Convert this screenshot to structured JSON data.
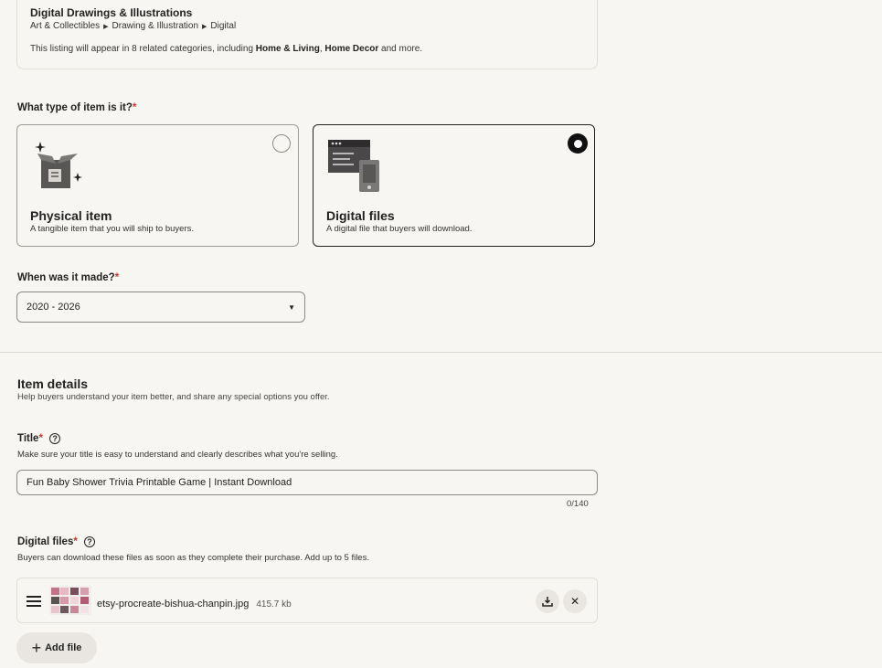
{
  "category": {
    "title": "Digital Drawings & Illustrations",
    "breadcrumb": [
      "Art & Collectibles",
      "Drawing & Illustration",
      "Digital"
    ],
    "note_prefix": "This listing will appear in 8 related categories, including ",
    "note_bold1": "Home & Living",
    "note_sep": ", ",
    "note_bold2": "Home Decor",
    "note_suffix": " and more."
  },
  "item_type": {
    "question": "What type of item is it?",
    "required_mark": "*",
    "options": [
      {
        "title": "Physical item",
        "desc": "A tangible item that you will ship to buyers.",
        "selected": false,
        "icon": "box-icon"
      },
      {
        "title": "Digital files",
        "desc": "A digital file that buyers will download.",
        "selected": true,
        "icon": "digital-files-icon"
      }
    ]
  },
  "when_made": {
    "question": "When was it made?",
    "required_mark": "*",
    "selected": "2020 - 2026"
  },
  "item_details": {
    "title": "Item details",
    "subtitle": "Help buyers understand your item better, and share any special options you offer."
  },
  "title_field": {
    "label": "Title",
    "required_mark": "*",
    "help": "?",
    "description": "Make sure your title is easy to understand and clearly describes what you're selling.",
    "value": "Fun Baby Shower Trivia Printable Game | Instant Download",
    "counter": "0/140"
  },
  "digital_files": {
    "label": "Digital files",
    "required_mark": "*",
    "help": "?",
    "description": "Buyers can download these files as soon as they complete their purchase. Add up to 5 files.",
    "files": [
      {
        "name": "etsy-procreate-bishua-chanpin.jpg",
        "size": "415.7 kb"
      }
    ],
    "add_label": "Add file"
  },
  "colors": {
    "background": "#f8f6f2",
    "required": "#c0392b",
    "selected_border": "#222222"
  }
}
